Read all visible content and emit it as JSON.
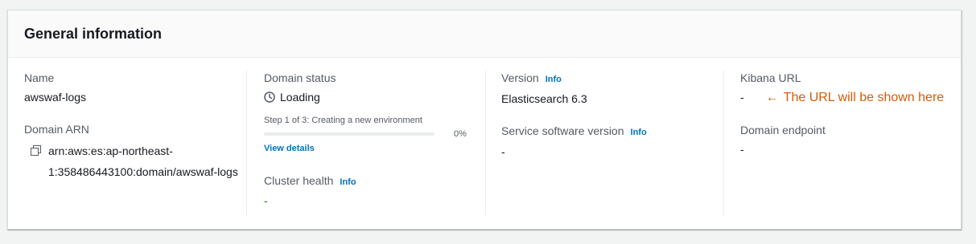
{
  "panel": {
    "title": "General information"
  },
  "name": {
    "label": "Name",
    "value": "awswaf-logs"
  },
  "domain_arn": {
    "label": "Domain ARN",
    "line1": "arn:aws:es:ap-northeast-",
    "line2": "1:358486443100:domain/awswaf-logs",
    "icon": "copy-icon"
  },
  "domain_status": {
    "label": "Domain status",
    "value": "Loading",
    "icon": "clock-icon",
    "progress": {
      "label": "Step 1 of 3: Creating a new environment",
      "percent": 0,
      "percent_text": "0%"
    },
    "view_details": "View details"
  },
  "cluster_health": {
    "label": "Cluster health",
    "info": "Info",
    "value": "-"
  },
  "version": {
    "label": "Version",
    "info": "Info",
    "value": "Elasticsearch 6.3"
  },
  "service_software": {
    "label": "Service software version",
    "info": "Info",
    "value": "-"
  },
  "kibana_url": {
    "label": "Kibana URL",
    "value": "-",
    "annotation_arrow": "←",
    "annotation": "The URL will be shown here"
  },
  "domain_endpoint": {
    "label": "Domain endpoint",
    "value": "-"
  },
  "colors": {
    "link": "#0073bb",
    "annotation": "#d45b07",
    "health_ok": "#1d8102",
    "label": "#545b64"
  }
}
